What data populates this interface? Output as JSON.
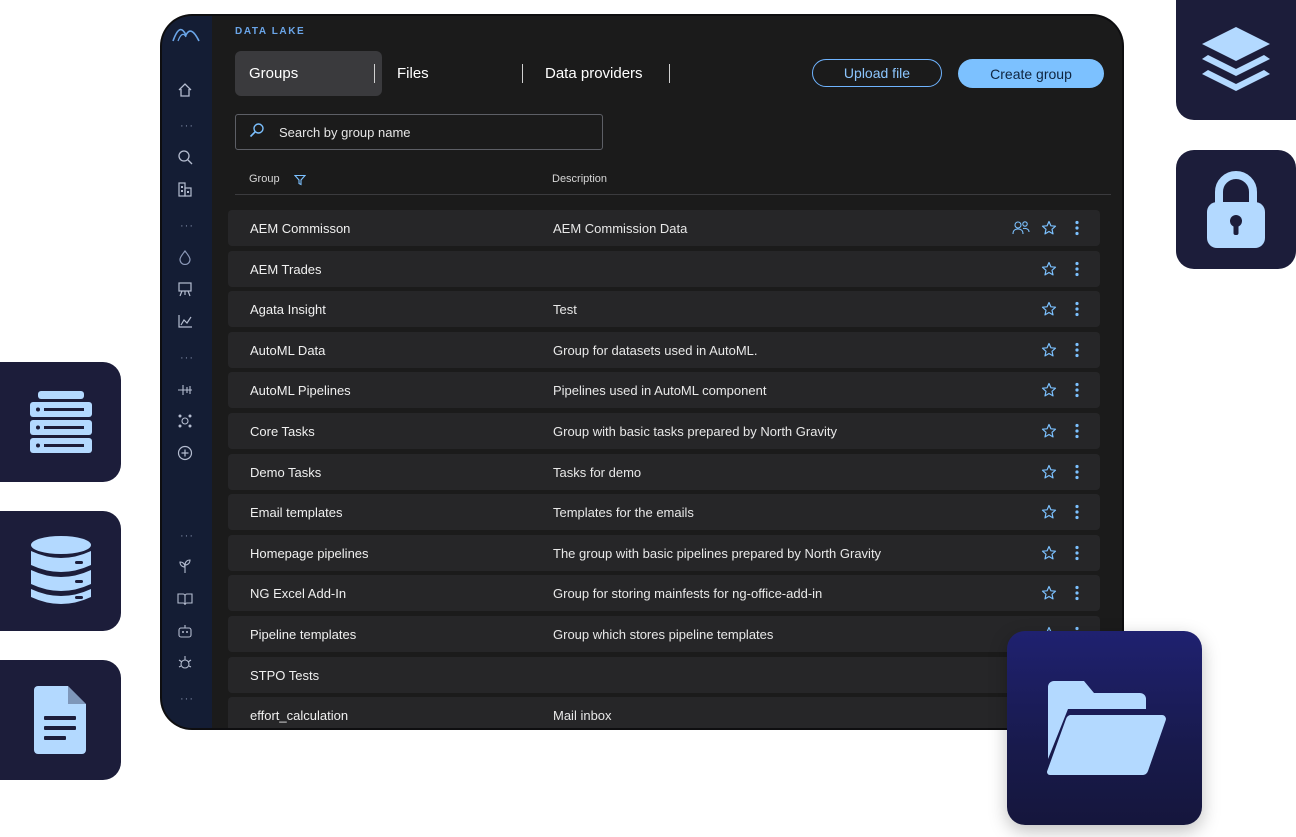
{
  "section_label": "DATA LAKE",
  "tabs": [
    {
      "label": "Groups",
      "active": true
    },
    {
      "label": "Files",
      "active": false
    },
    {
      "label": "Data providers",
      "active": false
    }
  ],
  "buttons": {
    "upload": "Upload file",
    "create": "Create group"
  },
  "search": {
    "placeholder": "Search by group name"
  },
  "columns": {
    "group": "Group",
    "description": "Description"
  },
  "rows": [
    {
      "name": "AEM Commisson",
      "description": "AEM Commission Data",
      "shared": true
    },
    {
      "name": "AEM Trades",
      "description": ""
    },
    {
      "name": "Agata Insight",
      "description": "Test"
    },
    {
      "name": "AutoML Data",
      "description": "Group for datasets used in AutoML."
    },
    {
      "name": "AutoML Pipelines",
      "description": "Pipelines used in AutoML component"
    },
    {
      "name": "Core Tasks",
      "description": "Group with basic tasks prepared by North Gravity"
    },
    {
      "name": "Demo Tasks",
      "description": "Tasks for demo"
    },
    {
      "name": "Email templates",
      "description": "Templates for the emails"
    },
    {
      "name": "Homepage pipelines",
      "description": "The group with basic pipelines prepared by North Gravity"
    },
    {
      "name": "NG Excel Add-In",
      "description": "Group for storing mainfests for ng-office-add-in"
    },
    {
      "name": "Pipeline templates",
      "description": "Group which stores pipeline templates"
    },
    {
      "name": "STPO Tests",
      "description": ""
    },
    {
      "name": "effort_calculation",
      "description": "Mail inbox"
    }
  ],
  "colors": {
    "accent": "#7cc1ff",
    "sidebar": "#141d34",
    "tile": "#1c1d3a",
    "icon_fill": "#b3d9ff"
  },
  "sidebar_icons": [
    "logo-icon",
    "home-icon",
    "search-icon",
    "buildings-icon",
    "droplet-icon",
    "easel-icon",
    "chart-icon",
    "timeline-icon",
    "network-icon",
    "add-circle-icon",
    "plant-icon",
    "book-icon",
    "robot-icon",
    "gear-bug-icon"
  ],
  "tiles": [
    "layers-icon",
    "lock-icon",
    "server-icon",
    "database-icon",
    "document-icon",
    "folder-open-icon"
  ]
}
